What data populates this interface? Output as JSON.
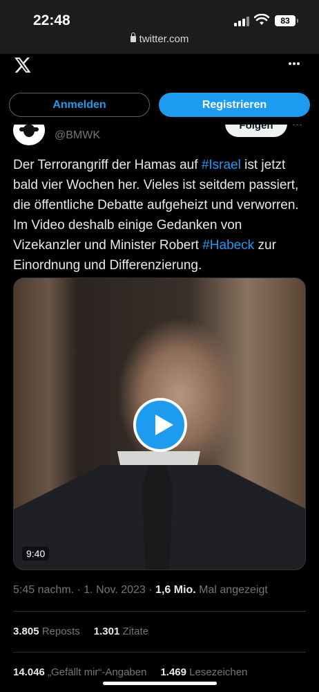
{
  "status_bar": {
    "time": "22:48",
    "url": "twitter.com",
    "battery": "83"
  },
  "header": {
    "logo_icon": "x-logo-icon",
    "menu_icon": "more-horizontal-icon"
  },
  "auth_bar": {
    "login_label": "Anmelden",
    "signup_label": "Registrieren"
  },
  "tweet": {
    "handle": "@BMWK",
    "follow_label": "Folgen",
    "text_parts": {
      "p1": "Der Terrorangriff der Hamas auf ",
      "hashtag1": "#Israel",
      "p2": " ist jetzt bald vier Wochen her. Vieles ist seitdem passiert, die öffentliche Debatte aufgeheizt und verworren. Im Video deshalb einige Gedanken von Vizekanzler und Minister Robert ",
      "hashtag2": "#Habeck",
      "p3": " zur Einordnung und Differenzierung."
    },
    "video": {
      "duration": "9:40",
      "play_icon": "play-icon"
    },
    "meta": {
      "time": "5:45 nachm.",
      "sep1": " · ",
      "date": "1. Nov. 2023",
      "sep2": " · ",
      "views": "1,6 Mio.",
      "views_label": " Mal angezeigt"
    },
    "stats": {
      "reposts": "3.805",
      "reposts_label": " Reposts",
      "quotes": "1.301",
      "quotes_label": " Zitate",
      "likes": "14.046",
      "likes_label": " „Gefällt mir“-Angaben",
      "bookmarks": "1.469",
      "bookmarks_label": " Lesezeichen"
    }
  },
  "colors": {
    "accent": "#1d9bf0",
    "background": "#000000",
    "text": "#e7e9ea",
    "muted": "#71767b"
  }
}
